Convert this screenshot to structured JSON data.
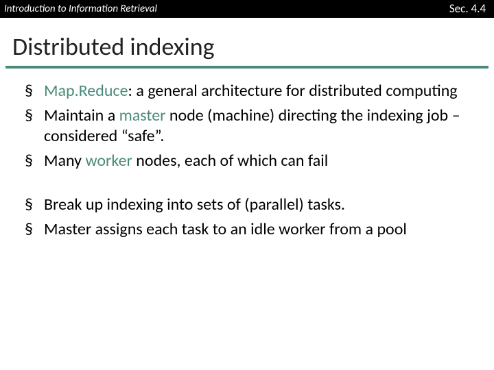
{
  "header": {
    "left": "Introduction to Information Retrieval",
    "right": "Sec. 4.4"
  },
  "title": "Distributed indexing",
  "bullets_top": [
    {
      "pre": "",
      "accent": "Map.Reduce",
      "post": ": a general architecture for distributed computing"
    },
    {
      "pre": "Maintain a ",
      "accent": "master",
      "post": " node (machine) directing the indexing job – considered “safe”."
    },
    {
      "pre": "Many ",
      "accent": "worker",
      "post": " nodes, each of which can fail"
    }
  ],
  "bullets_bottom": [
    {
      "pre": "Break up indexing into sets of (parallel) tasks.",
      "accent": "",
      "post": ""
    },
    {
      "pre": "Master assigns each task to an idle worker from a pool",
      "accent": "",
      "post": ""
    }
  ]
}
